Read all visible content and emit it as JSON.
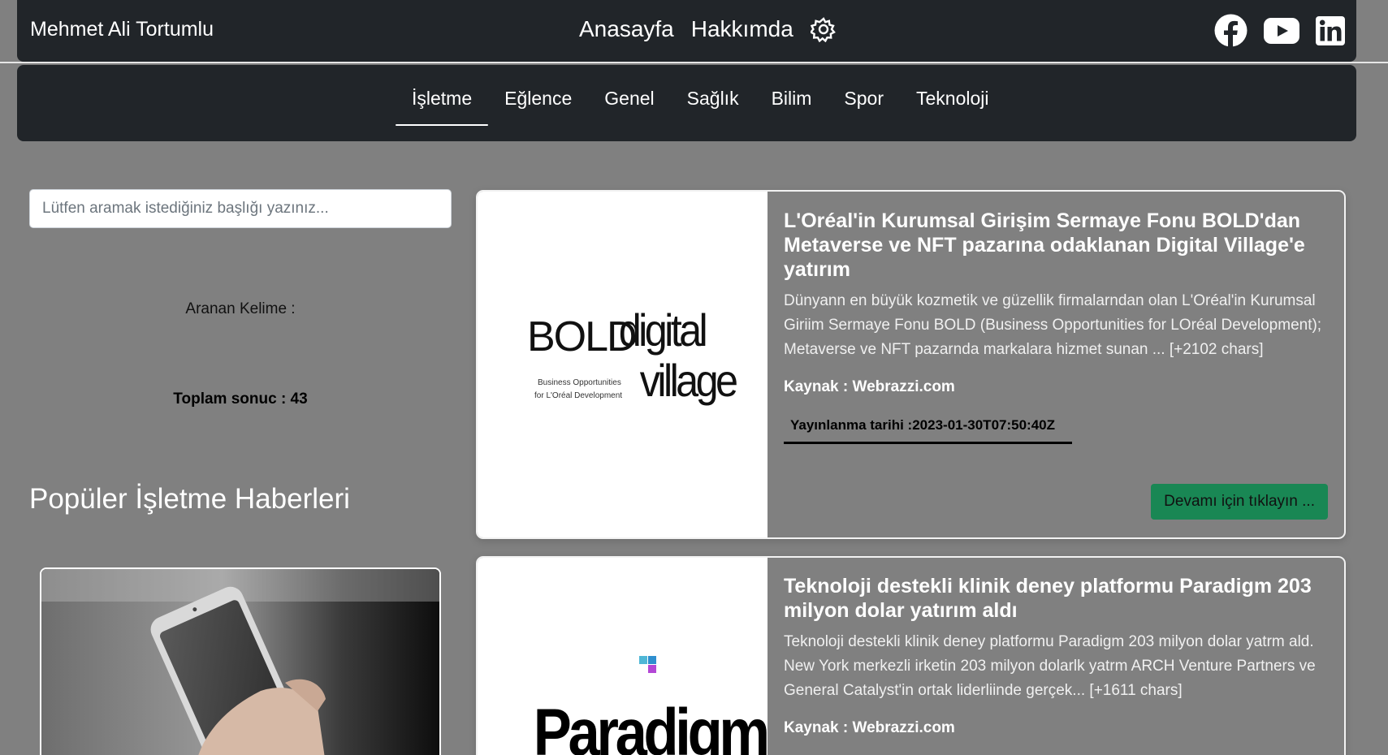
{
  "header": {
    "brand": "Mehmet Ali Tortumlu",
    "nav": [
      {
        "label": "Anasayfa"
      },
      {
        "label": "Hakkımda"
      }
    ],
    "settings_icon": "gear-icon",
    "social_icons": [
      "facebook-icon",
      "youtube-icon",
      "linkedin-icon"
    ]
  },
  "categories": [
    {
      "label": "İşletme",
      "active": true
    },
    {
      "label": "Eğlence"
    },
    {
      "label": "Genel"
    },
    {
      "label": "Sağlık"
    },
    {
      "label": "Bilim"
    },
    {
      "label": "Spor"
    },
    {
      "label": "Teknoloji"
    }
  ],
  "sidebar": {
    "search_placeholder": "Lütfen aramak istediğiniz başlığı yazınız...",
    "search_value": "",
    "keyword_label": "Aranan Kelime :",
    "total_label": "Toplam sonuc : 43",
    "popular_title": "Popüler İşletme Haberleri"
  },
  "articles": [
    {
      "title": "L'Oréal'in Kurumsal Girişim Sermaye Fonu BOLD'dan Metaverse ve NFT pazarına odaklanan Digital Village'e yatırım",
      "description": "Dünyann en büyük kozmetik ve güzellik firmalarndan olan L'Oréal'in Kurumsal Giriim Sermaye Fonu BOLD (Business Opportunities for LOréal Development); Metaverse ve NFT pazarnda markalara hizmet sunan ... [+2102 chars]",
      "source": "Kaynak : Webrazzi.com",
      "date": "Yayınlanma tarihi :2023-01-30T07:50:40Z",
      "button": "Devamı için tıklayın ...",
      "logo_bold": "BOLD",
      "logo_bold_sub1": "Business Opportunities",
      "logo_bold_sub2": "for L'Oréal Development",
      "logo_dv1": "digital",
      "logo_dv2": "village"
    },
    {
      "title": "Teknoloji destekli klinik deney platformu Paradigm 203 milyon dolar yatırım aldı",
      "description": "Teknoloji destekli klinik deney platformu Paradigm 203 milyon dolar yatrm ald. New York merkezli irketin 203 milyon dolarlk yatrm ARCH Venture Partners ve General Catalyst'in ortak liderliinde gerçek... [+1611 chars]",
      "source": "Kaynak : Webrazzi.com",
      "logo": "Paradigm"
    }
  ]
}
